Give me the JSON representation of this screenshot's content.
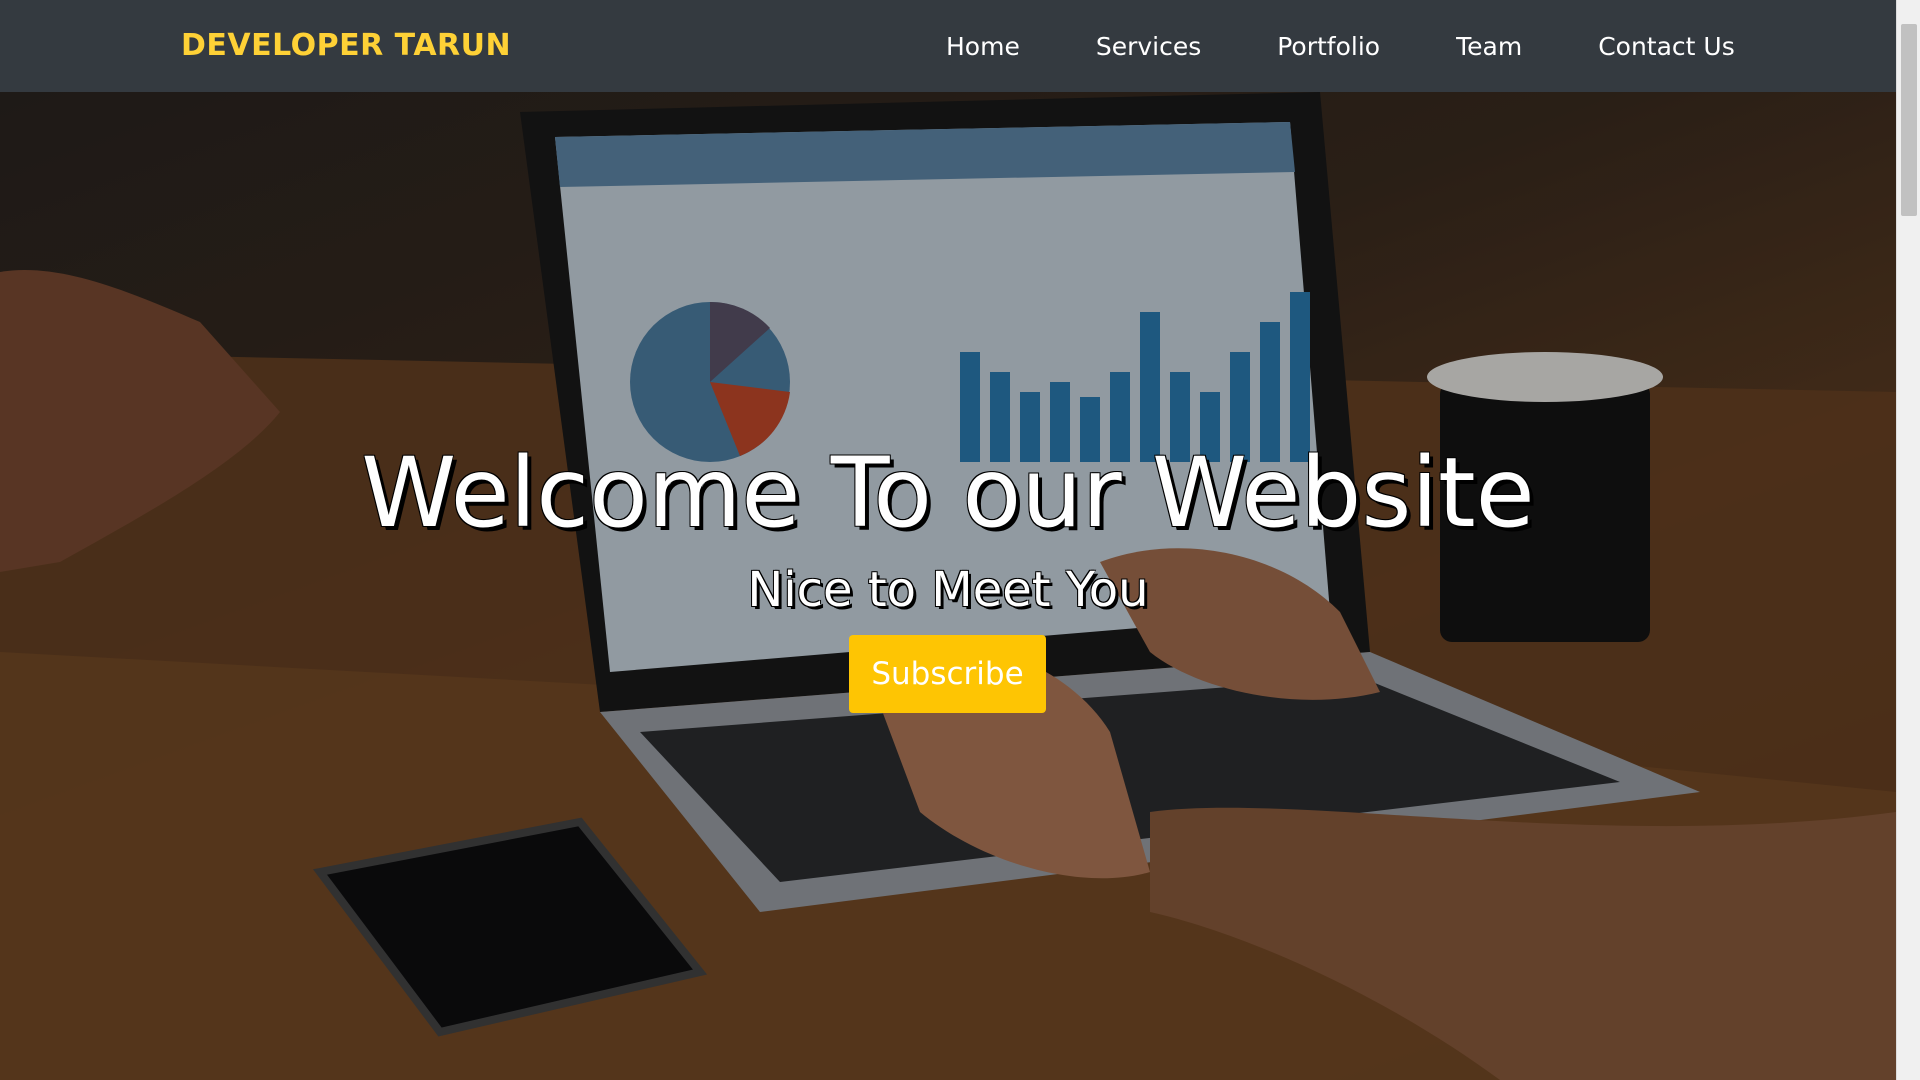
{
  "navbar": {
    "brand": "DEVELOPER TARUN",
    "links": [
      {
        "label": "Home"
      },
      {
        "label": "Services"
      },
      {
        "label": "Portfolio"
      },
      {
        "label": "Team"
      },
      {
        "label": "Contact Us"
      }
    ]
  },
  "hero": {
    "title": "Welcome To our Website",
    "subtitle": "Nice to Meet You",
    "button_label": "Subscribe"
  },
  "colors": {
    "navbar_bg": "#343a40",
    "brand": "#fed136",
    "button_bg": "#fec503",
    "text": "#ffffff"
  }
}
